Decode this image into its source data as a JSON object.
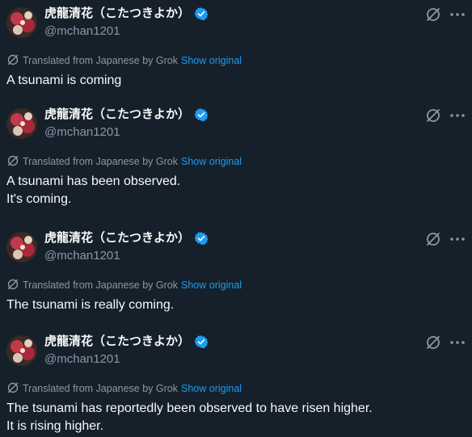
{
  "posts": [
    {
      "display_name": "虎龍清花（こたつきよか）",
      "handle": "@mchan1201",
      "translation_note": "Translated from Japanese by Grok",
      "show_original": "Show original",
      "lines": [
        "A tsunami is coming"
      ]
    },
    {
      "display_name": "虎龍清花（こたつきよか）",
      "handle": "@mchan1201",
      "translation_note": "Translated from Japanese by Grok",
      "show_original": "Show original",
      "lines": [
        "A tsunami has been observed.",
        "It's coming."
      ]
    },
    {
      "display_name": "虎龍清花（こたつきよか）",
      "handle": "@mchan1201",
      "translation_note": "Translated from Japanese by Grok",
      "show_original": "Show original",
      "lines": [
        "The tsunami is really coming."
      ]
    },
    {
      "display_name": "虎龍清花（こたつきよか）",
      "handle": "@mchan1201",
      "translation_note": "Translated from Japanese by Grok",
      "show_original": "Show original",
      "lines": [
        "The tsunami has reportedly been observed to have risen higher.",
        "It is rising higher."
      ]
    }
  ],
  "icons": {
    "verified": "verified-badge-icon",
    "grok": "grok-icon",
    "more": "more-dots-icon",
    "translate": "grok-translate-icon"
  },
  "colors": {
    "background": "#15202b",
    "text": "#f7f9f9",
    "muted": "#8b98a5",
    "accent": "#1d9bf0"
  }
}
